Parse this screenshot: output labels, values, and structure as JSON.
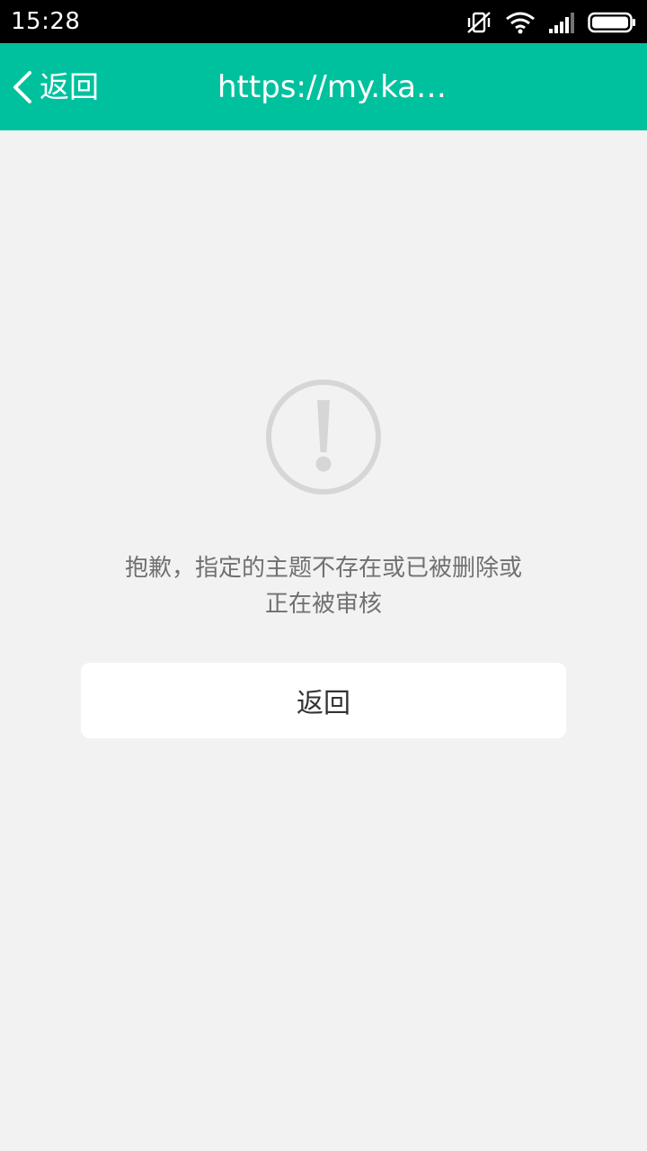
{
  "status_bar": {
    "time": "15:28",
    "icons": [
      "vibrate-off-icon",
      "wifi-icon",
      "cellular-signal-icon",
      "battery-icon"
    ]
  },
  "app_bar": {
    "back_label": "返回",
    "title": "https://my.ka…",
    "background_color": "#00c19e"
  },
  "content": {
    "icon": "warning-circle-icon",
    "message_line1": "抱歉，指定的主题不存在或已被删除或",
    "message_line2": "正在被审核",
    "button_label": "返回"
  }
}
